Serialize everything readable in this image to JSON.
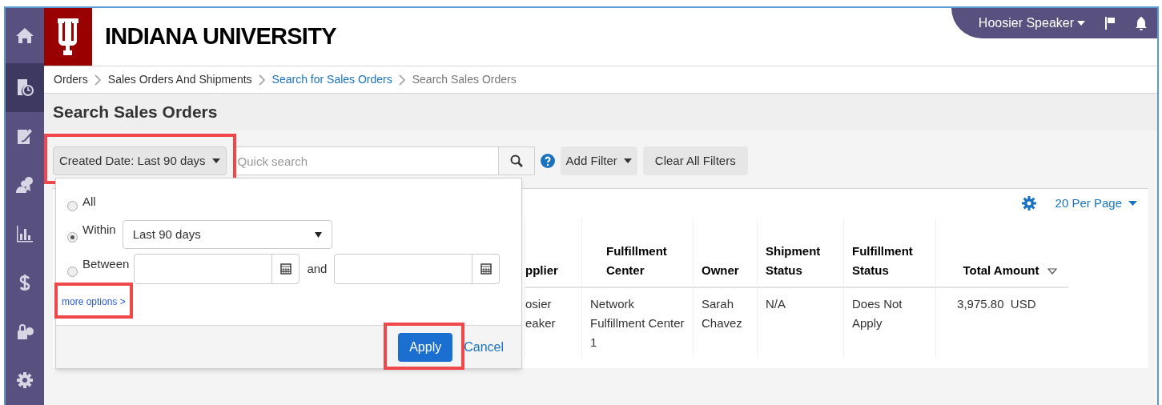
{
  "sidebar": {
    "items": [
      {
        "kind": "home",
        "selected": false
      },
      {
        "kind": "orders",
        "selected": true
      },
      {
        "kind": "edit",
        "selected": false
      },
      {
        "kind": "people",
        "selected": false
      },
      {
        "kind": "chart",
        "selected": false
      },
      {
        "kind": "dollar",
        "selected": false
      },
      {
        "kind": "lock",
        "selected": false
      },
      {
        "kind": "settings",
        "selected": false
      }
    ]
  },
  "header": {
    "logo_text": "INDIANA UNIVERSITY",
    "user_menu": "Hoosier Speaker"
  },
  "breadcrumb": [
    {
      "label": "Orders",
      "kind": "plain"
    },
    {
      "label": "Sales Orders And Shipments",
      "kind": "plain"
    },
    {
      "label": "Search for Sales Orders",
      "kind": "link"
    },
    {
      "label": "Search Sales Orders",
      "kind": "current"
    }
  ],
  "page_title": "Search Sales Orders",
  "toolbar": {
    "date_filter": {
      "label": "Created Date: Last 90 days",
      "highlighted": true
    },
    "search": {
      "placeholder": "Quick search"
    },
    "add_filter": "Add Filter",
    "clear_filters": "Clear All Filters"
  },
  "per_page": "20 Per Page",
  "table": {
    "columns": [
      {
        "label": "pplier",
        "sorted": false
      },
      {
        "label": "Fulfillment Center",
        "sorted": false
      },
      {
        "label": "Owner",
        "sorted": false
      },
      {
        "label": "Shipment Status",
        "sorted": false
      },
      {
        "label": "Fulfillment Status",
        "sorted": false
      },
      {
        "label": "Total Amount",
        "sorted": true
      }
    ],
    "rows": [
      {
        "cells": [
          "osier eaker",
          "Network Fulfillment Center 1",
          "Sarah Chavez",
          "N/A",
          "Does Not Apply",
          "3,975.80  USD"
        ]
      }
    ]
  },
  "date_popup": {
    "options": [
      {
        "label": "All",
        "selected": false,
        "kind": "plain"
      },
      {
        "label": "Within",
        "selected": true,
        "kind": "select",
        "value": "Last 90 days"
      },
      {
        "label": "Between",
        "selected": false,
        "kind": "range",
        "joiner": "and"
      }
    ],
    "more_options": {
      "label": "more options >",
      "highlighted": true
    },
    "apply": {
      "label": "Apply",
      "highlighted": true
    },
    "cancel": "Cancel"
  }
}
